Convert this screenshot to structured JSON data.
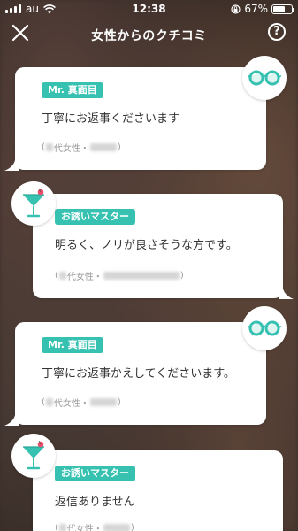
{
  "status_bar": {
    "carrier": "au",
    "time": "12:38",
    "battery": "67%",
    "battery_level": 0.67
  },
  "header": {
    "title": "女性からのクチコミ",
    "help": "?"
  },
  "reviews": [
    {
      "badge": "Mr. 真面目",
      "text": "丁寧にお返事くださいます",
      "age_label": "代女性",
      "separator": "・",
      "open": "(",
      "close": ")"
    },
    {
      "badge": "お誘いマスター",
      "text": "明るく、ノリが良さそうな方です。",
      "age_label": "代女性",
      "separator": "・",
      "open": "(",
      "close": ")"
    },
    {
      "badge": "Mr. 真面目",
      "text": "丁寧にお返事かえしてくださいます。",
      "age_label": "代女性",
      "separator": "・",
      "open": "(",
      "close": ")"
    },
    {
      "badge": "お誘いマスター",
      "text": "返信ありません",
      "age_label": "代女性",
      "separator": "・",
      "open": "(",
      "close": ")"
    }
  ],
  "colors": {
    "accent": "#37c1b1",
    "cocktail_cherry": "#ef4b6a"
  },
  "icons": {
    "glasses": "glasses-icon",
    "cocktail": "cocktail-icon"
  }
}
